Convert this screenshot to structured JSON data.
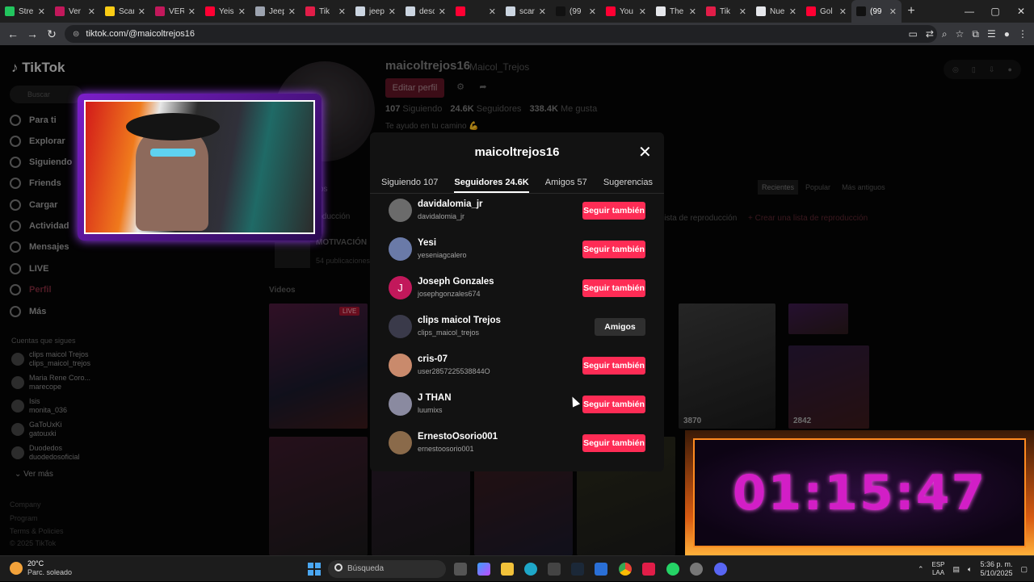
{
  "browser": {
    "tabs": [
      {
        "label": "Stre",
        "color": "#22c55e"
      },
      {
        "label": "Ver",
        "color": "#c2185b"
      },
      {
        "label": "Scar",
        "color": "#facc15"
      },
      {
        "label": "VER",
        "color": "#c2185b"
      },
      {
        "label": "Yeis",
        "color": "#ff0033"
      },
      {
        "label": "Jeep",
        "color": "#9ca3af"
      },
      {
        "label": "Tik",
        "color": "#e11d48"
      },
      {
        "label": "jeep",
        "color": "#cbd5e1"
      },
      {
        "label": "desc",
        "color": "#cbd5e1"
      },
      {
        "label": "",
        "color": "#ff0033"
      },
      {
        "label": "scar",
        "color": "#cbd5e1"
      },
      {
        "label": "(99",
        "color": "#111111"
      },
      {
        "label": "You",
        "color": "#ff0033"
      },
      {
        "label": "The",
        "color": "#e5e7eb"
      },
      {
        "label": "Tik",
        "color": "#e11d48"
      },
      {
        "label": "Nue",
        "color": "#e5e7eb"
      },
      {
        "label": "Gol",
        "color": "#ff0033"
      },
      {
        "label": "(99",
        "color": "#111111"
      }
    ],
    "active_tab_index": 17,
    "url": "tiktok.com/@maicoltrejos16"
  },
  "sidebar": {
    "logo": "TikTok",
    "search_placeholder": "Buscar",
    "nav": [
      {
        "label": "Para ti",
        "icon": "home-icon"
      },
      {
        "label": "Explorar",
        "icon": "compass-icon"
      },
      {
        "label": "Siguiendo",
        "icon": "following-icon"
      },
      {
        "label": "Friends",
        "icon": "friends-icon"
      },
      {
        "label": "Cargar",
        "icon": "upload-icon"
      },
      {
        "label": "Actividad",
        "icon": "activity-icon"
      },
      {
        "label": "Mensajes",
        "icon": "messages-icon"
      },
      {
        "label": "LIVE",
        "icon": "live-icon"
      },
      {
        "label": "Perfil",
        "icon": "profile-icon"
      },
      {
        "label": "Más",
        "icon": "more-icon"
      }
    ],
    "following_title": "Cuentas que sigues",
    "following": [
      {
        "name": "clips maicol Trejos",
        "user": "clips_maicol_trejos"
      },
      {
        "name": "Maria Rene Coro...",
        "user": "marecope"
      },
      {
        "name": "Isis",
        "user": "monita_036"
      },
      {
        "name": "GaToUxKi",
        "user": "gatouxki"
      },
      {
        "name": "Duodedos",
        "user": "duodedosoficial"
      }
    ],
    "see_more": "Ver más",
    "footer": [
      "Company",
      "Program",
      "Terms & Policies",
      "© 2025 TikTok"
    ]
  },
  "profile": {
    "username": "maicoltrejos16",
    "nickname": "Maicol_Trejos",
    "edit_label": "Editar perfil",
    "following_count": "107",
    "following_label": "Siguiendo",
    "followers_count": "24.6K",
    "followers_label": "Seguidores",
    "likes_count": "338.4K",
    "likes_label": "Me gusta",
    "bio": "Te ayudo en tu camino 💪",
    "sort_tabs": [
      "Recientes",
      "Popular",
      "Más antiguos"
    ],
    "playlist_label": "lista de reproducción",
    "create_playlist": "+ Crear una lista de reproducción",
    "playlist_title": "MOTIVACIÓN",
    "playlist_sub": "54 publicaciones",
    "production_label": "roducción",
    "posts_label": "os",
    "videos_title": "Videos",
    "live_badge": "LIVE",
    "video_counts": [
      "3870",
      "2842"
    ]
  },
  "modal": {
    "title": "maicoltrejos16",
    "tabs": [
      "Siguiendo 107",
      "Seguidores 24.6K",
      "Amigos 57",
      "Sugerencias"
    ],
    "active_tab": 1,
    "followers": [
      {
        "name": "davidalomia_jr",
        "user": "davidalomia_jr",
        "button": "Seguir también",
        "avatar_color": "#6b6b6b",
        "initial": ""
      },
      {
        "name": "Yesi",
        "user": "yeseniagcalero",
        "button": "Seguir también",
        "avatar_color": "#6a7aa8",
        "initial": ""
      },
      {
        "name": "Joseph Gonzales",
        "user": "josephgonzales674",
        "button": "Seguir también",
        "avatar_color": "#c2185b",
        "initial": "J"
      },
      {
        "name": "clips maicol Trejos",
        "user": "clips_maicol_trejos",
        "button": "Amigos",
        "avatar_color": "#3a3a4a",
        "initial": ""
      },
      {
        "name": "cris-07",
        "user": "user2857225538844O",
        "button": "Seguir también",
        "avatar_color": "#c98a6c",
        "initial": ""
      },
      {
        "name": "J THAN",
        "user": "luumixs",
        "button": "Seguir también",
        "avatar_color": "#8a8aa0",
        "initial": ""
      },
      {
        "name": "ErnestoOsorio001",
        "user": "ernestoosorio001",
        "button": "Seguir también",
        "avatar_color": "#8a6a4a",
        "initial": ""
      }
    ]
  },
  "timer": "01:15:47",
  "taskbar": {
    "temperature": "20°C",
    "weather": "Parc. soleado",
    "search_placeholder": "Búsqueda",
    "lang1": "ESP",
    "lang2": "LAA",
    "time": "5:36 p. m.",
    "date": "5/10/2025"
  }
}
